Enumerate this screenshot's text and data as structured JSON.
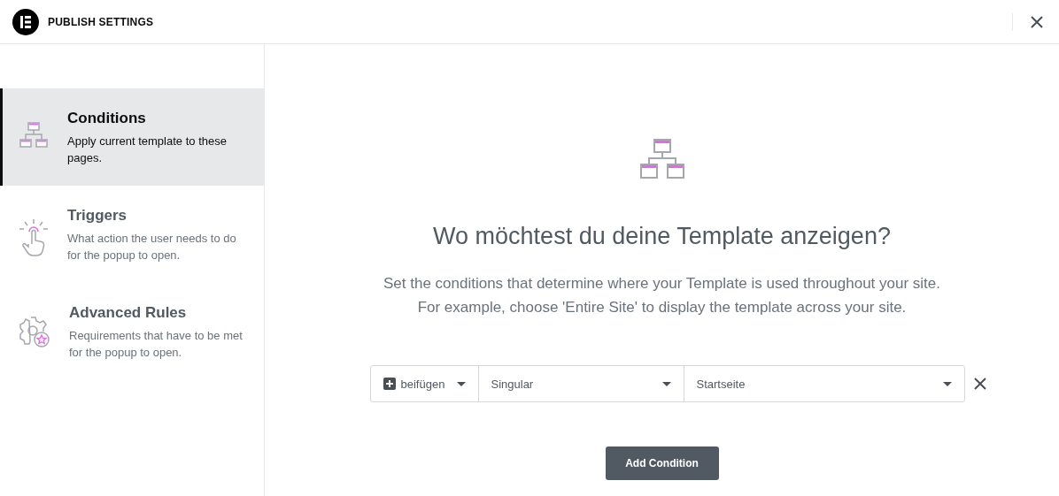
{
  "header": {
    "title": "PUBLISH SETTINGS"
  },
  "sidebar": {
    "items": [
      {
        "kind": "conditions",
        "title": "Conditions",
        "description": "Apply current template to these pages.",
        "selected": true
      },
      {
        "kind": "triggers",
        "title": "Triggers",
        "description": "What action the user needs to do for the popup to open.",
        "selected": false
      },
      {
        "kind": "advanced",
        "title": "Advanced Rules",
        "description": "Requirements that have to be met for the popup to open.",
        "selected": false
      }
    ]
  },
  "main": {
    "heading": "Wo möchtest du deine Template anzeigen?",
    "description": [
      "Set the conditions that determine where your Template is used throughout your site.",
      "For example, choose 'Entire Site' to display the template across your site."
    ],
    "condition": {
      "include": "beifügen",
      "type": "Singular",
      "target": "Startseite"
    },
    "button": "Add Condition"
  }
}
